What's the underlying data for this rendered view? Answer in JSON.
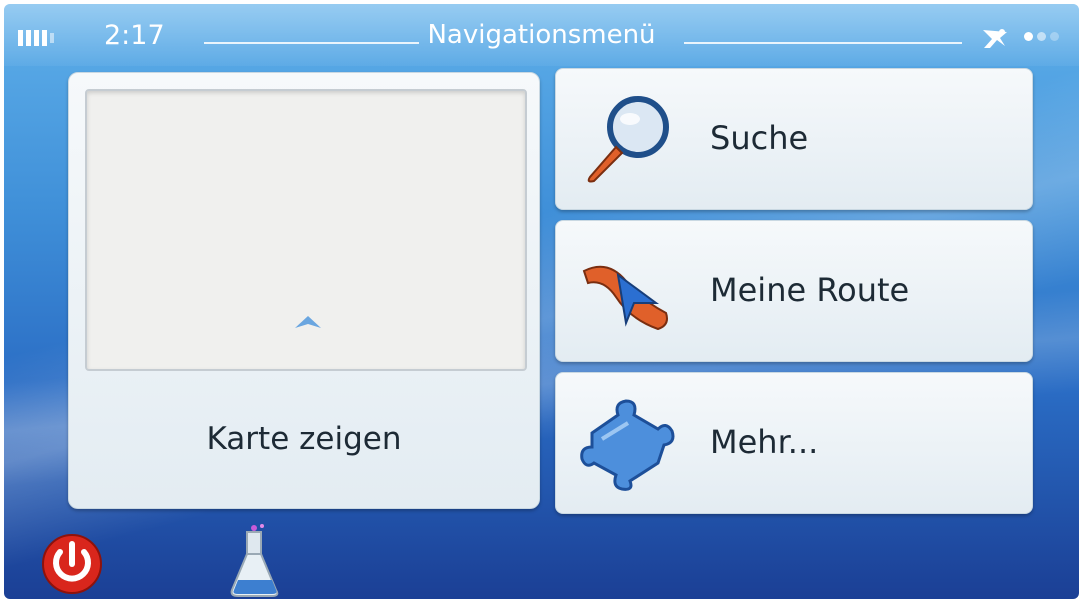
{
  "status": {
    "time": "2:17",
    "title": "Navigationsmenü",
    "battery_icon": "battery-icon",
    "gps_icon": "satellite-icon"
  },
  "menu": {
    "map_label": "Karte zeigen",
    "search_label": "Suche",
    "route_label": "Meine Route",
    "more_label": "Mehr..."
  },
  "toolbar": {
    "power_icon": "power-icon",
    "flask_icon": "flask-icon"
  },
  "colors": {
    "accent_orange": "#e0602a",
    "panel_bg": "#eef3f6",
    "power_red": "#d9261c",
    "screen_blue": "#3f8fd8"
  }
}
